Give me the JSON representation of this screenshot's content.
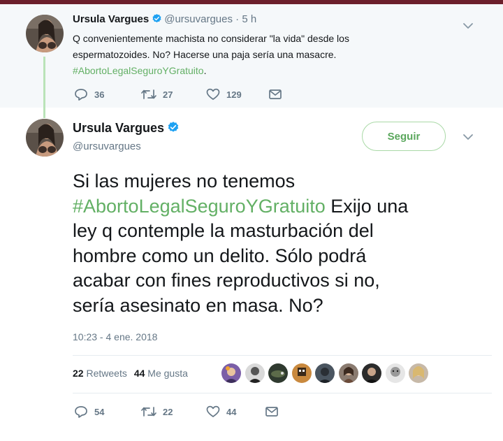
{
  "colors": {
    "hashtag": "#63b065",
    "verified": "#1da1f2",
    "follow": "#5aa75c",
    "thread_line": "#b9e3b8",
    "muted": "#657786"
  },
  "parent_tweet": {
    "name": "Ursula Vargues",
    "handle": "@ursuvargues",
    "separator": "·",
    "time": "5 h",
    "text_line_1": "Q convenientemente machista no considerar \"la vida\" desde los",
    "text_line_2": "espermatozoides. No? Hacerse una paja sería una masacre.",
    "hashtag": "#AbortoLegalSeguroYGratuito",
    "hashtag_suffix": ".",
    "reply_count": "36",
    "retweet_count": "27",
    "like_count": "129",
    "icons": [
      "verified-badge-icon",
      "chevron-down-icon",
      "reply-icon",
      "retweet-icon",
      "heart-icon",
      "envelope-icon"
    ]
  },
  "main_tweet": {
    "name": "Ursula Vargues",
    "handle": "@ursuvargues",
    "follow_label": "Seguir",
    "text_line_1": "Si las mujeres no tenemos",
    "hashtag": "#AbortoLegalSeguroYGratuito",
    "text_after_hashtag": " Exijo una",
    "text_line_3": "ley q contemple la masturbación del",
    "text_line_4": "hombre como un delito. Sólo podrá",
    "text_line_5": "acabar con fines reproductivos si no,",
    "text_line_6": "sería asesinato en masa. No?",
    "timestamp": "10:23 - 4 ene. 2018",
    "retweets_count": "22",
    "retweets_label": "Retweets",
    "likes_count": "44",
    "likes_label": "Me gusta",
    "reply_count": "54",
    "retweet_count": "22",
    "like_count": "44",
    "liker_avatars": 9
  }
}
